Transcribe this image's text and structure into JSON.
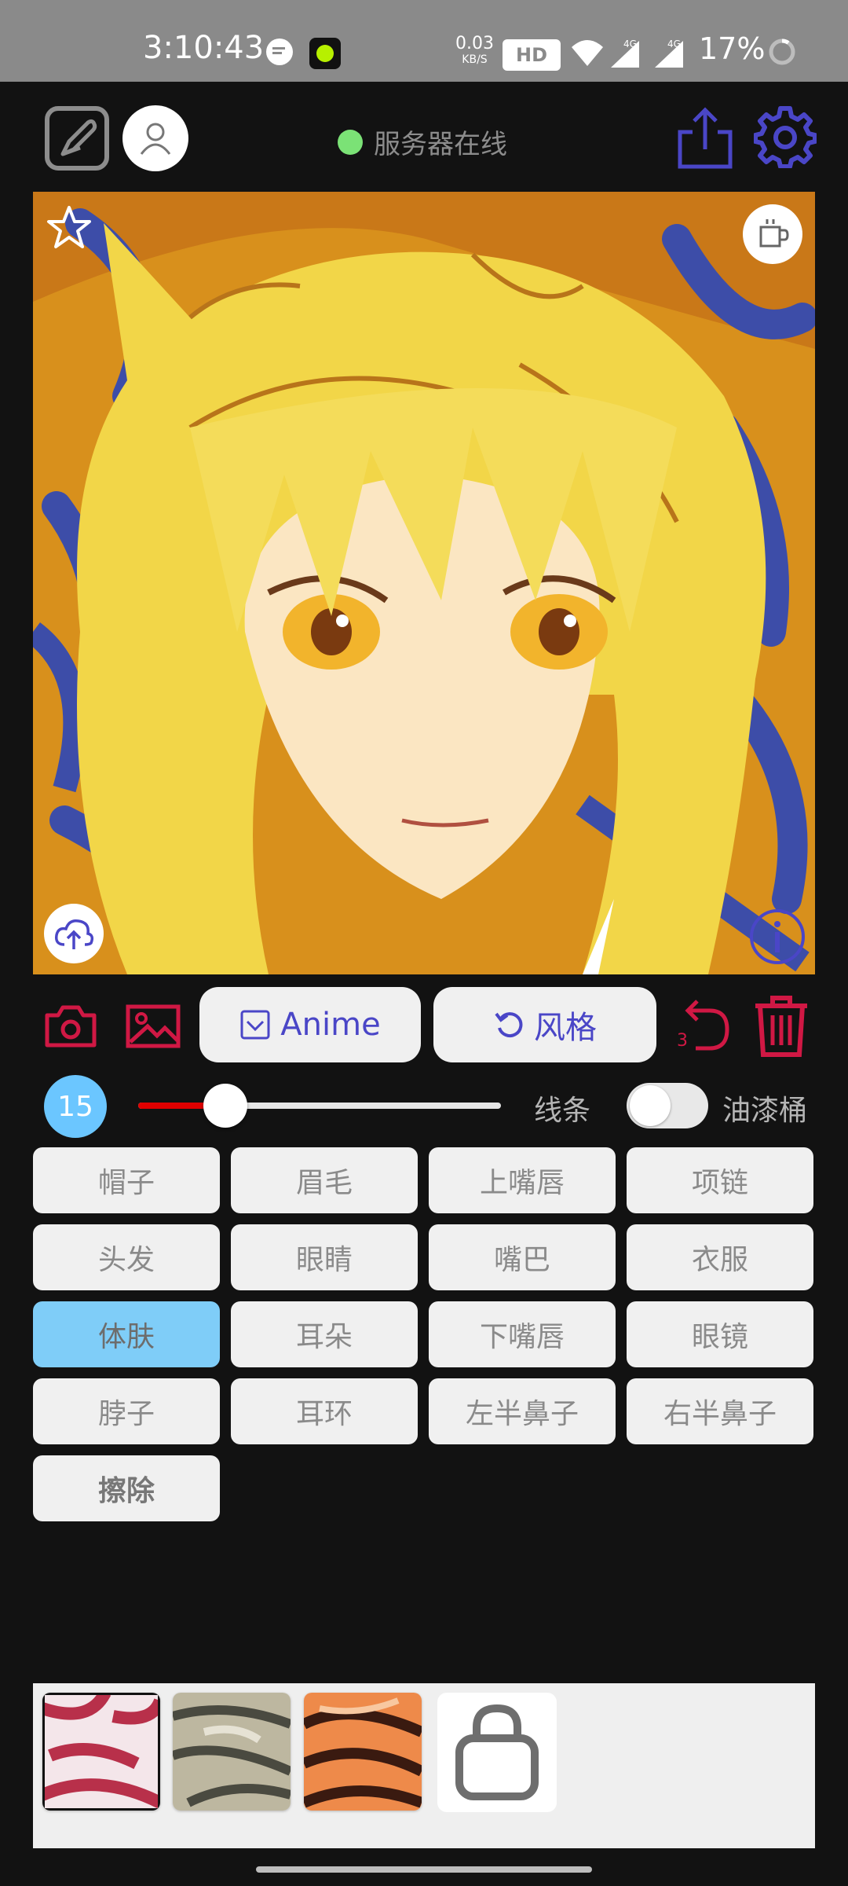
{
  "status_bar": {
    "time": "3:10:43",
    "net_speed_value": "0.03",
    "net_speed_unit": "KB/S",
    "hd_label": "HD",
    "signal_1": "4G",
    "signal_2": "4G",
    "battery": "17%"
  },
  "toolbar": {
    "server_status": "服务器在线",
    "server_color": "#7be276"
  },
  "actions": {
    "anime_label": "Anime",
    "style_label": "风格",
    "undo_count": "3",
    "accent": "#d01844",
    "pill_text_color": "#4a46c7"
  },
  "brush": {
    "size": "15",
    "slider_value": 0.24,
    "line_label": "线条",
    "bucket_label": "油漆桶",
    "bucket_enabled": false
  },
  "parts": [
    {
      "label": "帽子",
      "selected": false
    },
    {
      "label": "眉毛",
      "selected": false
    },
    {
      "label": "上嘴唇",
      "selected": false
    },
    {
      "label": "项链",
      "selected": false
    },
    {
      "label": "头发",
      "selected": false
    },
    {
      "label": "眼睛",
      "selected": false
    },
    {
      "label": "嘴巴",
      "selected": false
    },
    {
      "label": "衣服",
      "selected": false
    },
    {
      "label": "体肤",
      "selected": true
    },
    {
      "label": "耳朵",
      "selected": false
    },
    {
      "label": "下嘴唇",
      "selected": false
    },
    {
      "label": "眼镜",
      "selected": false
    },
    {
      "label": "脖子",
      "selected": false
    },
    {
      "label": "耳环",
      "selected": false
    },
    {
      "label": "左半鼻子",
      "selected": false
    },
    {
      "label": "右半鼻子",
      "selected": false
    },
    {
      "label": "擦除",
      "selected": false,
      "bold": true
    }
  ],
  "style_thumbs": [
    "pink-abstract",
    "gray-abstract",
    "orange-abstract"
  ]
}
